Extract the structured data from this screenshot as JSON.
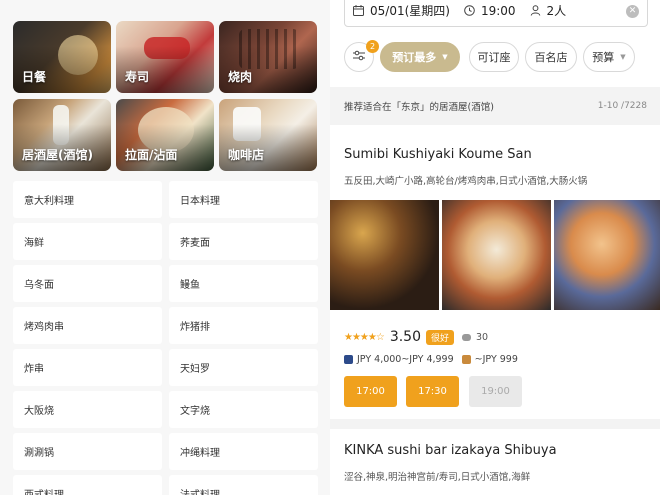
{
  "categories": [
    {
      "label": "日餐"
    },
    {
      "label": "寿司"
    },
    {
      "label": "烧肉"
    },
    {
      "label": "居酒屋(酒馆)"
    },
    {
      "label": "拉面/沾面"
    },
    {
      "label": "咖啡店"
    }
  ],
  "cuisine_list": [
    "意大利料理",
    "日本料理",
    "海鲜",
    "荞麦面",
    "乌冬面",
    "鳗鱼",
    "烤鸡肉串",
    "炸猪排",
    "炸串",
    "天妇罗",
    "大阪烧",
    "文字烧",
    "涮涮锅",
    "冲绳料理",
    "西式料理",
    "法式料理"
  ],
  "search": {
    "date": "05/01(星期四)",
    "time": "19:00",
    "people": "2人",
    "clear_icon": "close-icon"
  },
  "filters": {
    "filter_badge": "2",
    "sort": "预订最多",
    "bookable": "可订座",
    "top100": "百名店",
    "budget": "预算"
  },
  "results": {
    "heading": "推荐适合在「东京」的居酒屋(酒馆)",
    "count": "1-10 /7228"
  },
  "restaurant1": {
    "name": "Sumibi Kushiyaki Koume San",
    "tags": "五反田,大崎广小路,高轮台/烤鸡肉串,日式小酒馆,大肠火锅",
    "rating": 3.5,
    "stars": "★★★★☆",
    "score": "3.50",
    "badge": "很好",
    "comments": "30",
    "dinner_price": "JPY 4,000~JPY 4,999",
    "lunch_price": "~JPY 999",
    "slots": [
      "17:00",
      "17:30",
      "19:00"
    ]
  },
  "restaurant2": {
    "name": "KINKA sushi bar izakaya Shibuya",
    "tags": "涩谷,神泉,明治神宫前/寿司,日式小酒馆,海鲜"
  },
  "colors": {
    "accent": "#f0a11d",
    "selected_filter": "#c9ba8f",
    "dinner_icon": "#2c4a8a"
  }
}
